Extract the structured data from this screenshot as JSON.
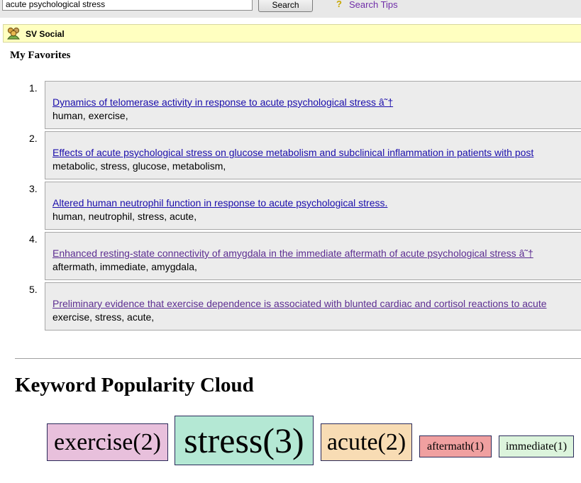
{
  "search": {
    "value": "acute psychological stress",
    "button_label": "Search",
    "tips_icon": "?",
    "tips_label": "Search Tips"
  },
  "social": {
    "icon": "people-icon",
    "label": "SV Social"
  },
  "favorites": {
    "title": "My Favorites",
    "items": [
      {
        "number": "1.",
        "title": "Dynamics of telomerase activity in response to acute psychological stress â˜†",
        "tags": "human, exercise,",
        "visited": false
      },
      {
        "number": "2.",
        "title": "Effects of acute psychological stress on glucose metabolism and subclinical inflammation in patients with post",
        "tags": "metabolic, stress, glucose, metabolism,",
        "visited": false
      },
      {
        "number": "3.",
        "title": "Altered human neutrophil function in response to acute psychological stress.",
        "tags": "human, neutrophil, stress, acute,",
        "visited": false
      },
      {
        "number": "4.",
        "title": "Enhanced resting-state connectivity of amygdala in the immediate aftermath of acute psychological stress â˜†",
        "tags": "aftermath, immediate, amygdala,",
        "visited": true
      },
      {
        "number": "5.",
        "title": "Preliminary evidence that exercise dependence is associated with blunted cardiac and cortisol reactions to acute",
        "tags": "exercise, stress, acute,",
        "visited": true
      }
    ]
  },
  "cloud": {
    "title": "Keyword Popularity Cloud",
    "keywords": [
      {
        "label": "exercise(2)",
        "count": 2,
        "color": "#e8c0dc"
      },
      {
        "label": "stress(3)",
        "count": 3,
        "color": "#b4e8d4"
      },
      {
        "label": "acute(2)",
        "count": 2,
        "color": "#f8dcb4"
      },
      {
        "label": "aftermath(1)",
        "count": 1,
        "color": "#f0a0a0"
      },
      {
        "label": "immediate(1)",
        "count": 1,
        "color": "#dcf4dc"
      }
    ]
  },
  "colors": {
    "link": "#1a0dab",
    "visited_link": "#5c2d91",
    "social_bar": "#ffffc0",
    "item_background": "#ececec"
  }
}
